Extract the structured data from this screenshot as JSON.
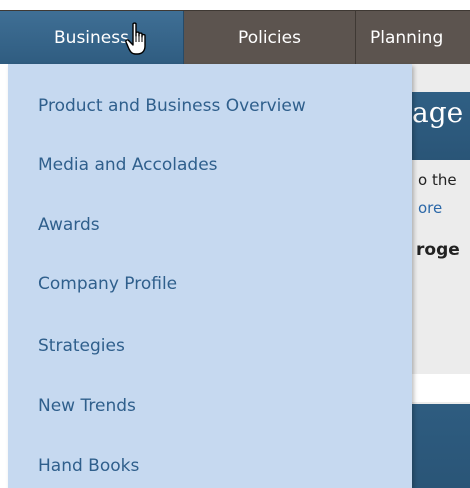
{
  "nav": {
    "items": [
      {
        "label": "Business"
      },
      {
        "label": "Policies"
      },
      {
        "label": "Planning"
      }
    ]
  },
  "content": {
    "heading": "age",
    "line1": "o the",
    "line2": "ore",
    "line3": "roge"
  },
  "dropdown": {
    "items": [
      {
        "label": "Product and Business Overview"
      },
      {
        "label": "Media and Accolades"
      },
      {
        "label": "Awards"
      },
      {
        "label": "Company Profile"
      },
      {
        "label": "Strategies"
      },
      {
        "label": "New Trends"
      },
      {
        "label": "Hand Books"
      }
    ]
  },
  "colors": {
    "nav_bg": "#5c544f",
    "nav_active": "#2f5c80",
    "dropdown_bg": "#c6d9f0",
    "dropdown_text": "#2f5f8c",
    "content_band": "#2a5577"
  },
  "cursor": {
    "icon": "hand-pointer-icon"
  }
}
